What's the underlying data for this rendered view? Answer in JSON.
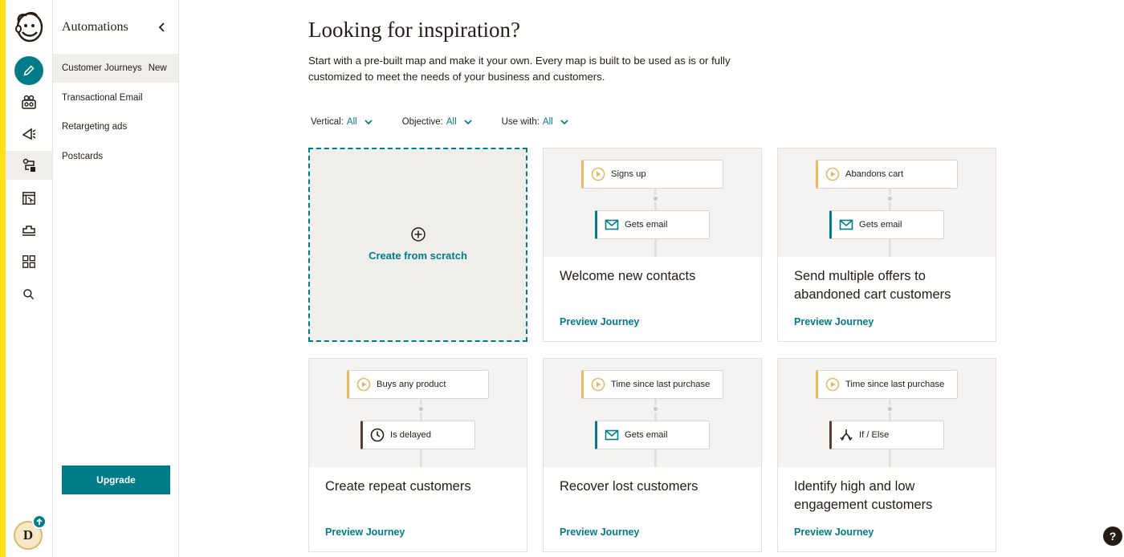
{
  "rail": {
    "items": [
      {
        "name": "create-icon"
      },
      {
        "name": "audience-icon"
      },
      {
        "name": "campaigns-icon"
      },
      {
        "name": "automations-icon"
      },
      {
        "name": "website-icon"
      },
      {
        "name": "integrations-icon"
      },
      {
        "name": "content-icon"
      },
      {
        "name": "search-icon"
      }
    ],
    "avatar_initial": "D"
  },
  "subnav": {
    "title": "Automations",
    "items": [
      {
        "label": "Customer Journeys",
        "badge": "New"
      },
      {
        "label": "Transactional Email"
      },
      {
        "label": "Retargeting ads"
      },
      {
        "label": "Postcards"
      }
    ],
    "upgrade_label": "Upgrade"
  },
  "main": {
    "title": "Looking for inspiration?",
    "description": "Start with a pre-built map and make it your own. Every map is built to be used as is or fully customized to meet the needs of your business and customers.",
    "filters": [
      {
        "label": "Vertical:",
        "value": "All"
      },
      {
        "label": "Objective:",
        "value": "All"
      },
      {
        "label": "Use with:",
        "value": "All"
      }
    ],
    "scratch_label": "Create from scratch",
    "cards": [
      {
        "trigger": "Signs up",
        "action": "Gets email",
        "title": "Welcome new contacts",
        "link": "Preview Journey"
      },
      {
        "trigger": "Abandons cart",
        "action": "Gets email",
        "title": "Send multiple offers to abandoned cart customers",
        "link": "Preview Journey"
      },
      {
        "trigger": "Buys any product",
        "action": "Is delayed",
        "title": "Create repeat customers",
        "link": "Preview Journey"
      },
      {
        "trigger": "Time since last purchase",
        "action": "Gets email",
        "title": "Recover lost customers",
        "link": "Preview Journey"
      },
      {
        "trigger": "Time since last purchase",
        "action": "If / Else",
        "title": "Identify high and low engagement customers",
        "link": "Preview Journey"
      }
    ]
  },
  "help_label": "?",
  "colors": {
    "accent": "#007c89",
    "brand_yellow": "#ffe01b",
    "trigger_border": "#e8b866",
    "delay_border": "#5a3d30"
  }
}
